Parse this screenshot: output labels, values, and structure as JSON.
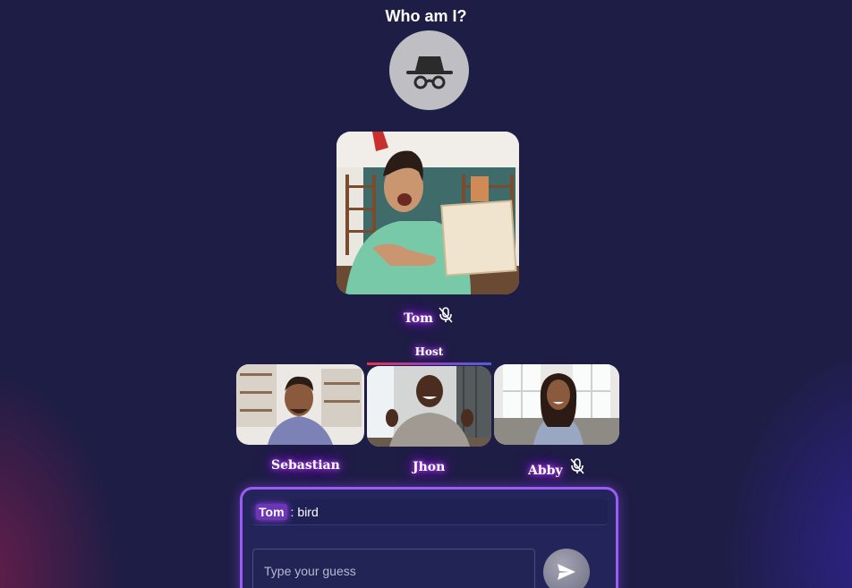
{
  "header": {
    "title": "Who am I?"
  },
  "mystery_avatar": {
    "icon": "incognito-icon"
  },
  "featured": {
    "name": "Tom",
    "mic_icon": "mic-off-icon"
  },
  "host": {
    "label": "Host"
  },
  "participants": [
    {
      "name": "Sebastian"
    },
    {
      "name": "Jhon"
    },
    {
      "name": "Abby",
      "mic_icon": "mic-off-icon"
    }
  ],
  "chat": {
    "messages": [
      {
        "sender": "Tom",
        "separator": ":",
        "text": "bird"
      }
    ],
    "input_placeholder": "Type your guess",
    "send_icon": "send-icon"
  },
  "colors": {
    "background": "#1e1d45",
    "chat_border": "#9b5cf5",
    "name_glow": "#a020f0",
    "host_bar_start": "#e8324a",
    "host_bar_end": "#4e5fd8"
  }
}
